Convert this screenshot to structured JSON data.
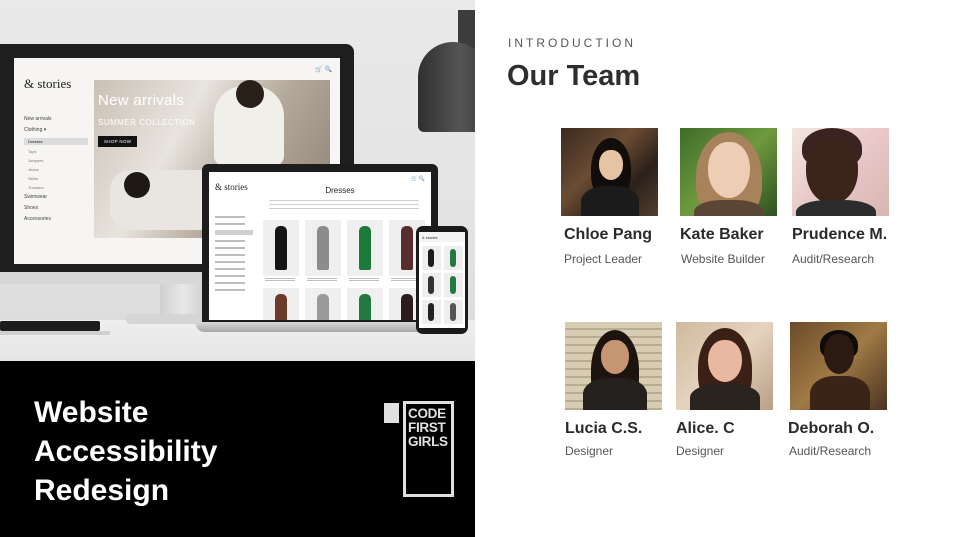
{
  "mockup": {
    "brand": "& stories",
    "desktop": {
      "nav": [
        "New arrivals",
        "Clothing ▾",
        "Dresses",
        "Tops",
        "Jumpers",
        "Jeans",
        "Skirts",
        "Trousers",
        "Swimwear",
        "Shoes",
        "Accessories"
      ],
      "banner_title": "New arrivals",
      "banner_subtitle": "SUMMER COLLECTION",
      "banner_button": "SHOP NOW",
      "icons": "🛒 🔍"
    },
    "laptop": {
      "page_title": "Dresses",
      "icons": "🛒 🔍"
    },
    "phone": {
      "brand": "& stories"
    }
  },
  "project": {
    "title_lines": [
      "Website",
      "Accessibility",
      "Redesign"
    ]
  },
  "badge": {
    "lines": [
      "CODE",
      "FIRST",
      "GIRLS"
    ]
  },
  "intro": {
    "kicker": "INTRODUCTION",
    "heading": "Our Team"
  },
  "team": [
    {
      "name": "Chloe Pang",
      "role": "Project Leader"
    },
    {
      "name": "Kate Baker",
      "role": "Website Builder"
    },
    {
      "name": "Prudence M.",
      "role": "Audit/Research"
    },
    {
      "name": "Lucia C.S.",
      "role": "Designer"
    },
    {
      "name": "Alice. C",
      "role": "Designer"
    },
    {
      "name": "Deborah O.",
      "role": "Audit/Research"
    }
  ]
}
